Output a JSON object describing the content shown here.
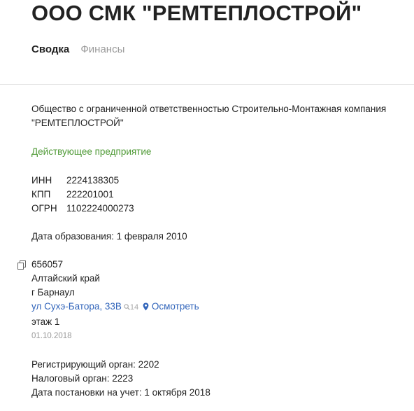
{
  "company": {
    "title": "ООО СМК \"РЕМТЕПЛОСТРОЙ\"",
    "full_name": "Общество с ограниченной ответственностью Строительно-Монтажная компания \"РЕМТЕПЛОСТРОЙ\"",
    "status": "Действующее предприятие"
  },
  "tabs": [
    {
      "label": "Сводка",
      "active": true
    },
    {
      "label": "Финансы",
      "active": false
    }
  ],
  "codes": [
    {
      "key": "ИНН",
      "value": "2224138305"
    },
    {
      "key": "КПП",
      "value": "222201001"
    },
    {
      "key": "ОГРН",
      "value": "1102224000273"
    }
  ],
  "founded": "Дата образования: 1 февраля 2010",
  "address": {
    "postcode": "656057",
    "region": "Алтайский край",
    "city": "г Барнаул",
    "street": "ул Сухэ-Батора, 33В",
    "views": "14",
    "view_link": "Осмотреть",
    "floor": "этаж 1",
    "date": "01.10.2018"
  },
  "registration": {
    "reg_authority": "Регистрирующий орган: 2202",
    "tax_authority": "Налоговый орган: 2223",
    "reg_date": "Дата постановки на учет: 1 октября 2018"
  },
  "colors": {
    "status_green": "#4f9a36",
    "link_blue": "#3366bb",
    "muted_gray": "#9a9a9a"
  }
}
